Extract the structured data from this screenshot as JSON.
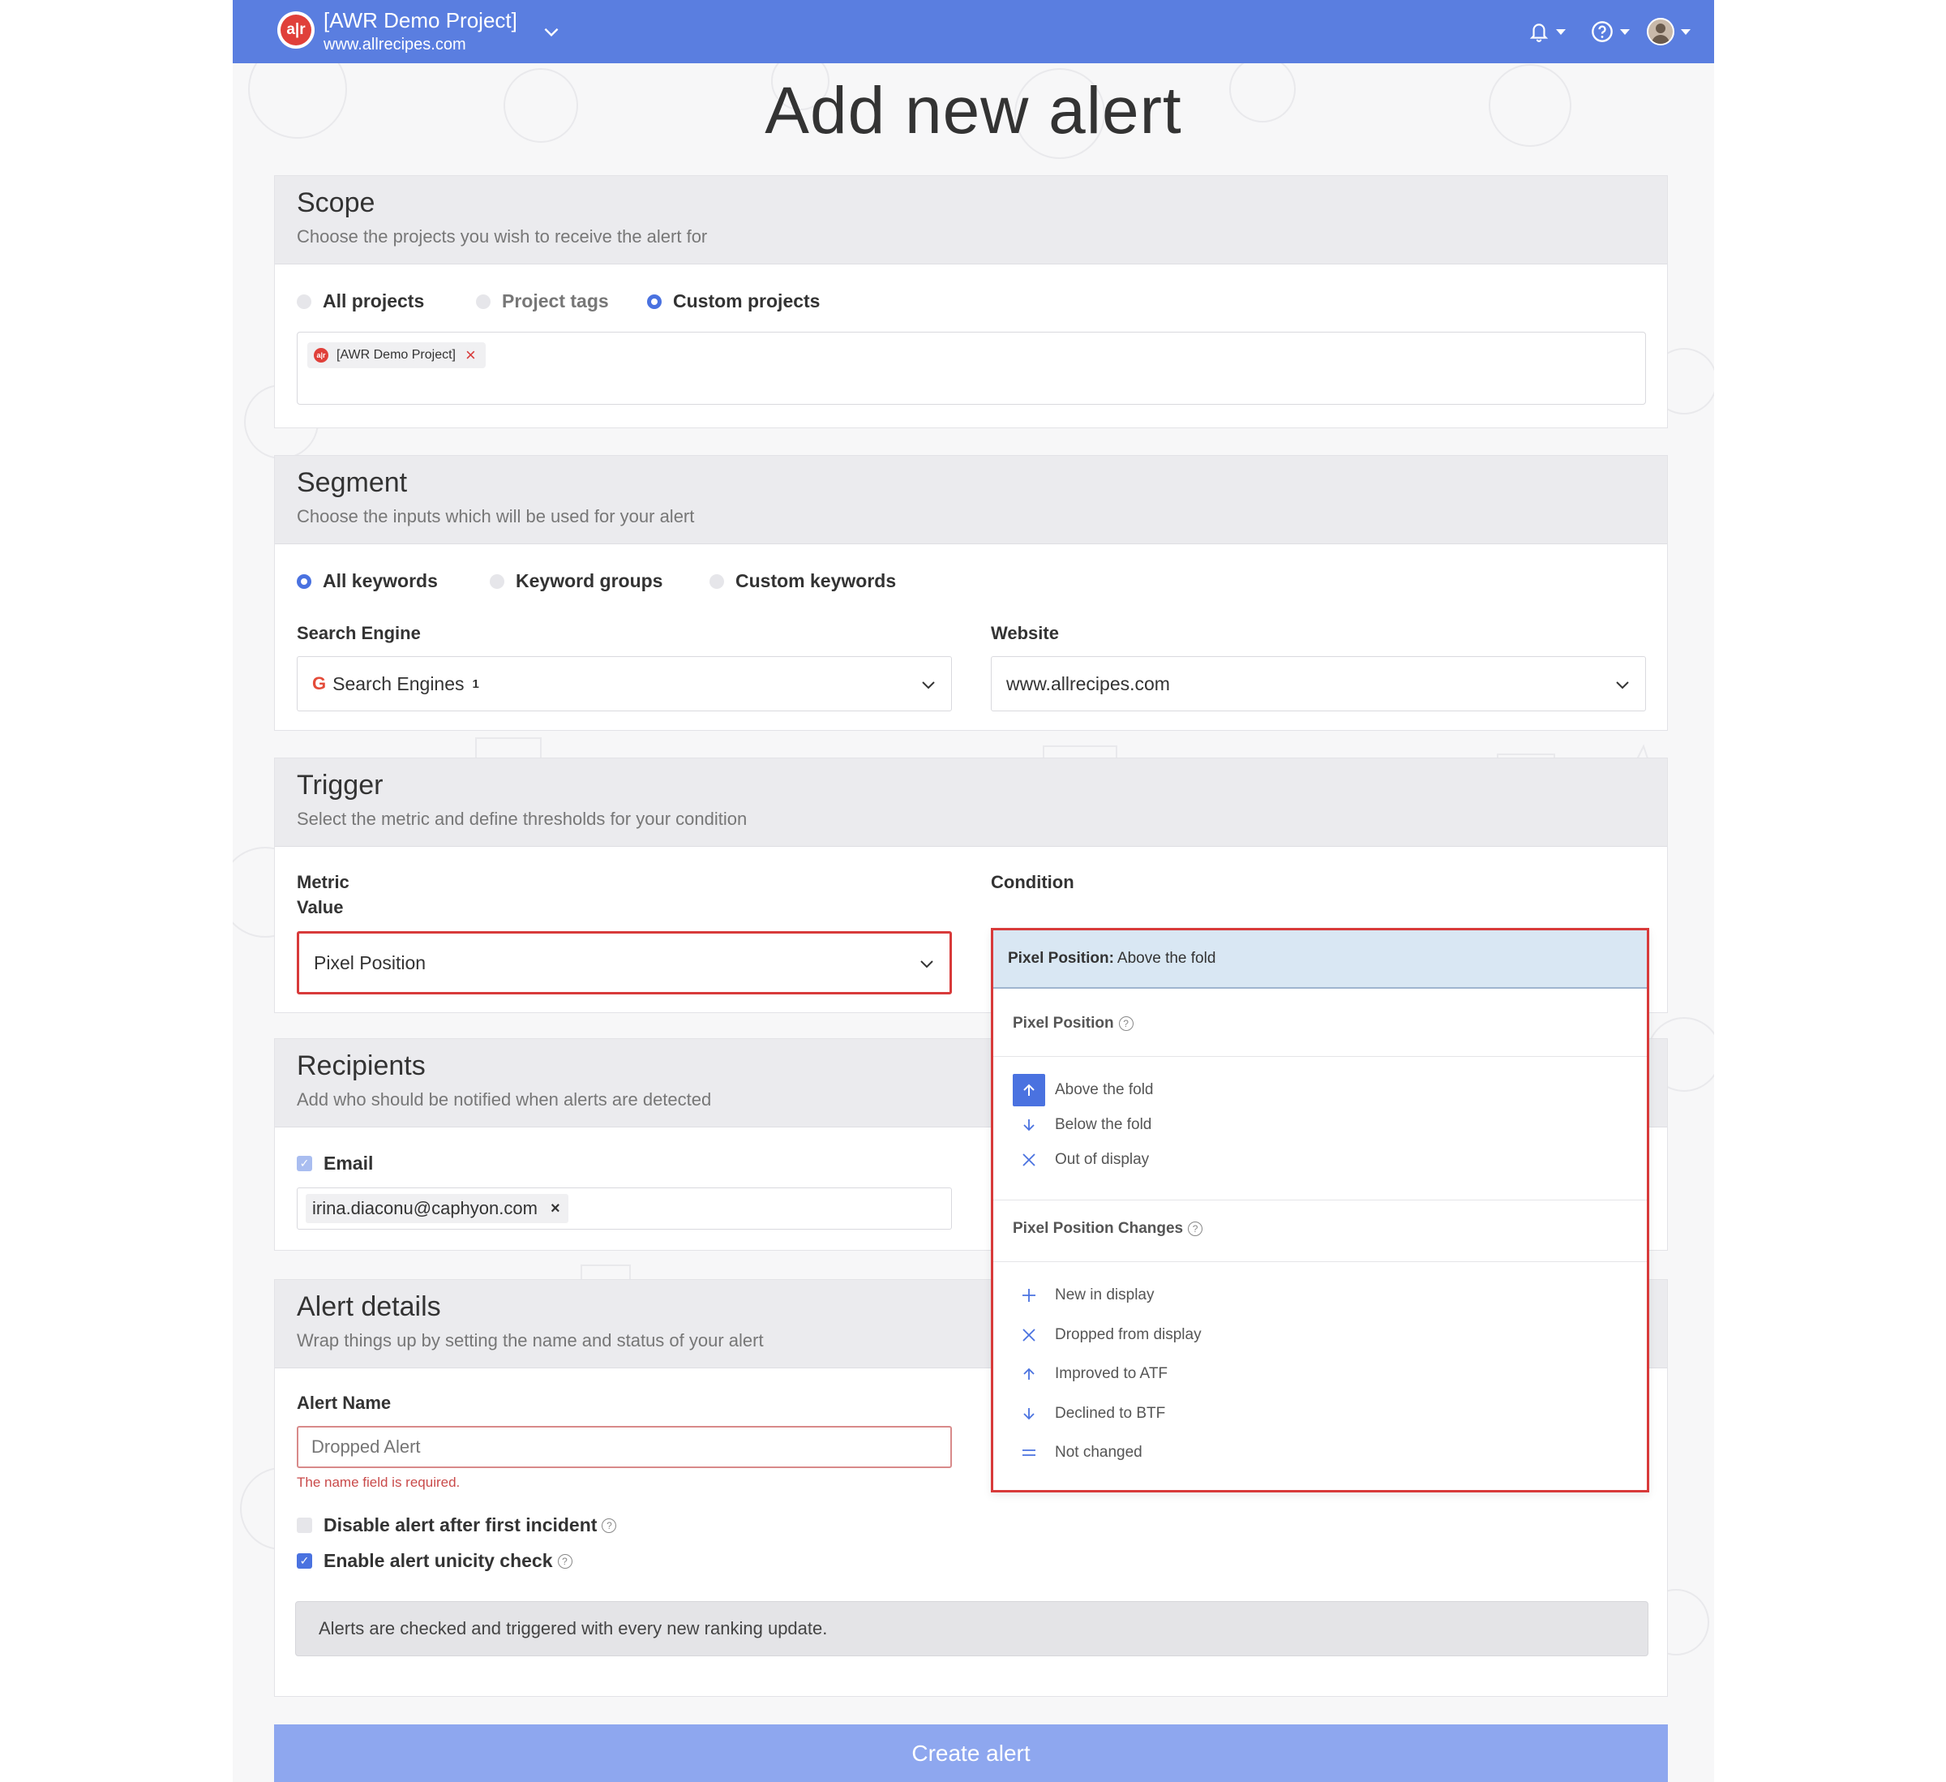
{
  "header": {
    "project_name": "[AWR Demo Project]",
    "project_url": "www.allrecipes.com",
    "logo_text": "a|r",
    "brand_color": "#5a7ee0"
  },
  "page_title": "Add new alert",
  "scope": {
    "title": "Scope",
    "subtitle": "Choose the projects you wish to receive the alert for",
    "options": [
      "All projects",
      "Project tags",
      "Custom projects"
    ],
    "selected": "Custom projects",
    "tags": [
      {
        "label": "[AWR Demo Project]"
      }
    ]
  },
  "segment": {
    "title": "Segment",
    "subtitle": "Choose the inputs which will be used for your alert",
    "options": [
      "All keywords",
      "Keyword groups",
      "Custom keywords"
    ],
    "selected": "All keywords",
    "search_engine_label": "Search Engine",
    "search_engine_value": "Search Engines",
    "search_engine_count": "1",
    "website_label": "Website",
    "website_value": "www.allrecipes.com"
  },
  "trigger": {
    "title": "Trigger",
    "subtitle": "Select the metric and define thresholds for your condition",
    "metric_label_line1": "Metric",
    "metric_label_line2": "Value",
    "metric_value": "Pixel Position",
    "condition_label": "Condition"
  },
  "condition_dropdown": {
    "selected_prefix": "Pixel Position:",
    "selected_value": "Above the fold",
    "group1_label": "Pixel Position",
    "group1_items": [
      {
        "label": "Above the fold",
        "icon": "arrow-up-icon",
        "active": true
      },
      {
        "label": "Below the fold",
        "icon": "arrow-down-icon"
      },
      {
        "label": "Out of display",
        "icon": "x-icon"
      }
    ],
    "group2_label": "Pixel Position Changes",
    "group2_items": [
      {
        "label": "New in display",
        "icon": "plus-icon"
      },
      {
        "label": "Dropped from display",
        "icon": "x-icon"
      },
      {
        "label": "Improved to ATF",
        "icon": "arrow-up-icon"
      },
      {
        "label": "Declined to BTF",
        "icon": "arrow-down-icon"
      },
      {
        "label": "Not changed",
        "icon": "equals-icon"
      }
    ]
  },
  "recipients": {
    "title": "Recipients",
    "subtitle": "Add who should be notified when alerts are detected",
    "email_label": "Email",
    "email_checked": true,
    "emails": [
      "irina.diaconu@caphyon.com"
    ]
  },
  "alert_details": {
    "title": "Alert details",
    "subtitle": "Wrap things up by setting the name and status of your alert",
    "name_label": "Alert Name",
    "name_placeholder": "Dropped Alert",
    "name_error": "The name field is required.",
    "disable_label": "Disable alert after first incident",
    "disable_checked": false,
    "unicity_label": "Enable alert unicity check",
    "unicity_checked": true,
    "info_text": "Alerts are checked and triggered with every new ranking update."
  },
  "create_button": "Create alert",
  "colors": {
    "accent": "#4a72e0",
    "error": "#d83a3a",
    "button": "#8ea7ef"
  }
}
